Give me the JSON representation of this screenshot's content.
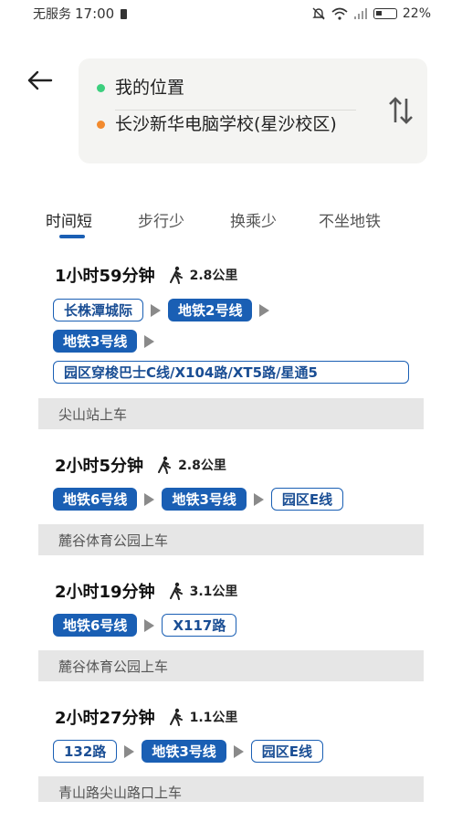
{
  "status_bar": {
    "carrier": "无服务",
    "time": "17:00",
    "battery": "22%"
  },
  "route": {
    "from": "我的位置",
    "to": "长沙新华电脑学校(星沙校区)"
  },
  "tabs": [
    {
      "label": "时间短",
      "active": true
    },
    {
      "label": "步行少",
      "active": false
    },
    {
      "label": "换乘少",
      "active": false
    },
    {
      "label": "不坐地铁",
      "active": false
    }
  ],
  "plans": [
    {
      "duration": "1小时59分钟",
      "walk": "2.8公里",
      "lines": [
        [
          {
            "label": "长株潭城际",
            "style": "outline"
          },
          {
            "label": "地铁2号线",
            "style": "solid"
          }
        ],
        [
          {
            "label": "地铁3号线",
            "style": "solid"
          }
        ],
        [
          {
            "label": "园区穿梭巴士C线/X104路/XT5路/星通5",
            "style": "outline"
          }
        ]
      ],
      "boarding": "尖山站上车"
    },
    {
      "duration": "2小时5分钟",
      "walk": "2.8公里",
      "lines": [
        [
          {
            "label": "地铁6号线",
            "style": "solid"
          },
          {
            "label": "地铁3号线",
            "style": "solid"
          },
          {
            "label": "园区E线",
            "style": "outline"
          }
        ]
      ],
      "boarding": "麓谷体育公园上车"
    },
    {
      "duration": "2小时19分钟",
      "walk": "3.1公里",
      "lines": [
        [
          {
            "label": "地铁6号线",
            "style": "solid"
          },
          {
            "label": "X117路",
            "style": "outline"
          }
        ]
      ],
      "boarding": "麓谷体育公园上车"
    },
    {
      "duration": "2小时27分钟",
      "walk": "1.1公里",
      "lines": [
        [
          {
            "label": "132路",
            "style": "outline"
          },
          {
            "label": "地铁3号线",
            "style": "solid"
          },
          {
            "label": "园区E线",
            "style": "outline"
          }
        ]
      ],
      "boarding": "青山路尖山路口上车"
    }
  ],
  "colors": {
    "accent": "#1a5fb4",
    "origin_dot": "#3ccf7e",
    "destination_dot": "#f28a2e"
  }
}
